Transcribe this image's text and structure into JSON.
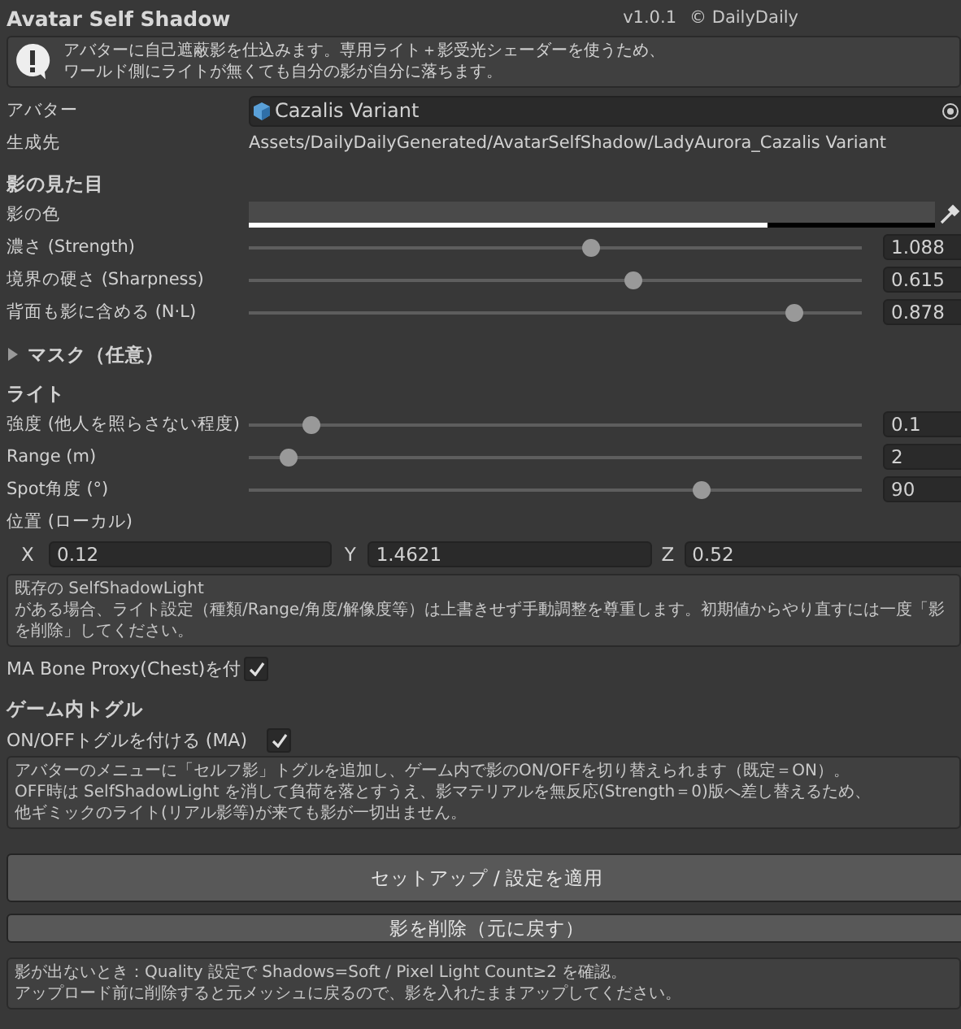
{
  "header": {
    "title": "Avatar Self Shadow",
    "version": "v1.0.1",
    "credit": "© DailyDaily"
  },
  "intro": {
    "lines": [
      "アバターに自己遮蔽影を仕込みます。専用ライト＋影受光シェーダーを使うため、",
      "ワールド側にライトが無くても自分の影が自分に落ちます。"
    ]
  },
  "avatar": {
    "label": "アバター",
    "value": "Cazalis Variant"
  },
  "output": {
    "label": "生成先",
    "value": "Assets/DailyDailyGenerated/AvatarSelfShadow/LadyAurora_Cazalis Variant"
  },
  "appearance": {
    "heading": "影の見た目",
    "color_label": "影の色",
    "color": "#4a4a4a",
    "alpha": {
      "level": 0.757
    },
    "sliders": [
      {
        "label": "濃さ (Strength)",
        "level": 0.557,
        "value": "1.088"
      },
      {
        "label": "境界の硬さ (Sharpness)",
        "level": 0.626,
        "value": "0.615"
      },
      {
        "label": "背面も影に含める (N·L)",
        "level": 0.889,
        "value": "0.878"
      }
    ]
  },
  "mask": {
    "label": "マスク（任意）",
    "expanded": false
  },
  "light": {
    "heading": "ライト",
    "sliders": [
      {
        "label": "強度 (他人を照らさない程度)",
        "level": 0.1,
        "value": "0.1"
      },
      {
        "label": "Range (m)",
        "level": 0.064,
        "value": "2"
      },
      {
        "label": "Spot角度 (°)",
        "level": 0.737,
        "value": "90"
      }
    ],
    "position_label": "位置 (ローカル)",
    "position": [
      {
        "axis": "X",
        "value": "0.12"
      },
      {
        "axis": "Y",
        "value": "1.4621"
      },
      {
        "axis": "Z",
        "value": "0.52"
      }
    ],
    "note": "既存の SelfShadowLight\nがある場合、ライト設定（種類/Range/角度/解像度等）は上書きせず手動調整を尊重します。初期値からやり直すには一度「影を削除」してください。"
  },
  "bone_proxy": {
    "label": "MA Bone Proxy(Chest)を付",
    "checked": true
  },
  "toggle": {
    "heading": "ゲーム内トグル",
    "label": "ON/OFFトグルを付ける (MA)",
    "checked": true,
    "note": [
      "アバターのメニューに「セルフ影」トグルを追加し、ゲーム内で影のON/OFFを切り替えられます（既定＝ON）。",
      "OFF時は SelfShadowLight を消して負荷を落とすうえ、影マテリアルを無反応(Strength＝0)版へ差し替えるため、",
      "他ギミックのライト(リアル影等)が来ても影が一切出ません。"
    ]
  },
  "buttons": [
    {
      "label": "セットアップ / 設定を適用",
      "kind": "primary"
    },
    {
      "label": "影を削除（元に戻す）",
      "kind": "secondary"
    }
  ],
  "footer": [
    "影が出ないとき：Quality 設定で Shadows=Soft / Pixel Light Count≥2 を確認。",
    "アップロード前に削除すると元メッシュに戻るので、影を入れたままアップしてください。"
  ]
}
